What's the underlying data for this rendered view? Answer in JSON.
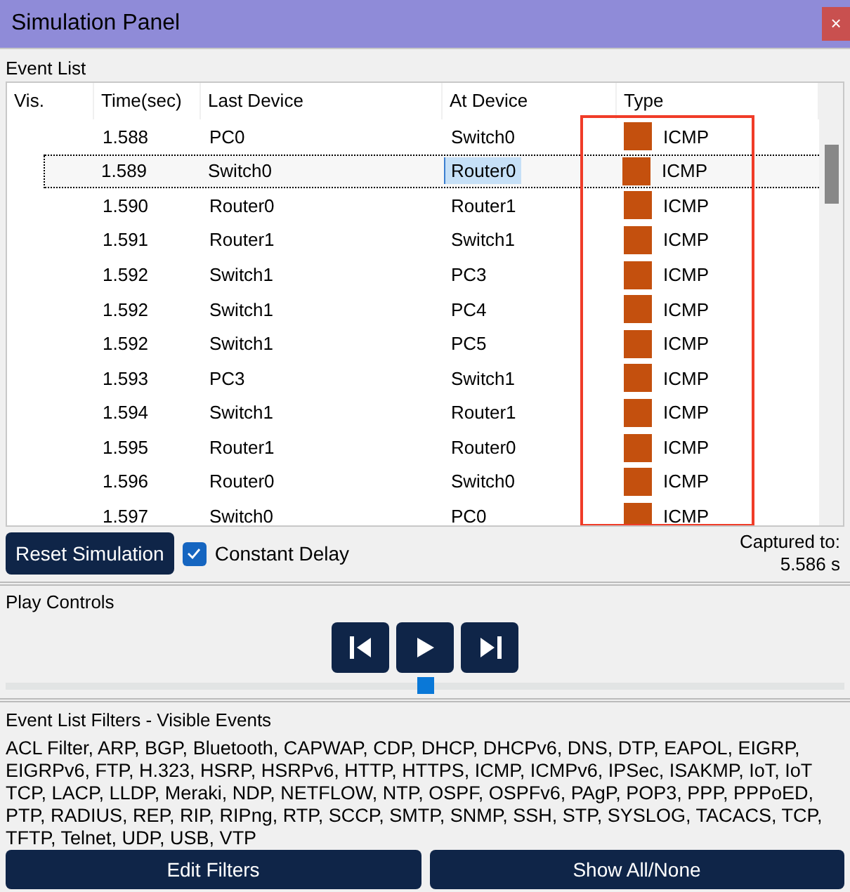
{
  "window": {
    "title": "Simulation Panel",
    "close": "×"
  },
  "event_list": {
    "label": "Event List",
    "columns": [
      "Vis.",
      "Time(sec)",
      "Last Device",
      "At Device",
      "Type"
    ],
    "rows": [
      {
        "time": "1.588",
        "last_device": "PC0",
        "at_device": "Switch0",
        "type": "ICMP",
        "color": "#c4500e",
        "selected": false
      },
      {
        "time": "1.589",
        "last_device": "Switch0",
        "at_device": "Router0",
        "type": "ICMP",
        "color": "#c4500e",
        "selected": true
      },
      {
        "time": "1.590",
        "last_device": "Router0",
        "at_device": "Router1",
        "type": "ICMP",
        "color": "#c4500e",
        "selected": false
      },
      {
        "time": "1.591",
        "last_device": "Router1",
        "at_device": "Switch1",
        "type": "ICMP",
        "color": "#c4500e",
        "selected": false
      },
      {
        "time": "1.592",
        "last_device": "Switch1",
        "at_device": "PC3",
        "type": "ICMP",
        "color": "#c4500e",
        "selected": false
      },
      {
        "time": "1.592",
        "last_device": "Switch1",
        "at_device": "PC4",
        "type": "ICMP",
        "color": "#c4500e",
        "selected": false
      },
      {
        "time": "1.592",
        "last_device": "Switch1",
        "at_device": "PC5",
        "type": "ICMP",
        "color": "#c4500e",
        "selected": false
      },
      {
        "time": "1.593",
        "last_device": "PC3",
        "at_device": "Switch1",
        "type": "ICMP",
        "color": "#c4500e",
        "selected": false
      },
      {
        "time": "1.594",
        "last_device": "Switch1",
        "at_device": "Router1",
        "type": "ICMP",
        "color": "#c4500e",
        "selected": false
      },
      {
        "time": "1.595",
        "last_device": "Router1",
        "at_device": "Router0",
        "type": "ICMP",
        "color": "#c4500e",
        "selected": false
      },
      {
        "time": "1.596",
        "last_device": "Router0",
        "at_device": "Switch0",
        "type": "ICMP",
        "color": "#c4500e",
        "selected": false
      },
      {
        "time": "1.597",
        "last_device": "Switch0",
        "at_device": "PC0",
        "type": "ICMP",
        "color": "#c4500e",
        "selected": false
      }
    ]
  },
  "reset_button": "Reset Simulation",
  "constant_delay": {
    "label": "Constant Delay",
    "checked": true
  },
  "captured": {
    "label": "Captured to:",
    "value": "5.586 s"
  },
  "play_controls": {
    "label": "Play Controls",
    "level": 0.5
  },
  "filters": {
    "label": "Event List Filters - Visible Events",
    "text": "ACL Filter, ARP, BGP, Bluetooth, CAPWAP, CDP, DHCP, DHCPv6, DNS, DTP, EAPOL, EIGRP, EIGRPv6, FTP, H.323, HSRP, HSRPv6, HTTP, HTTPS, ICMP, ICMPv6, IPSec, ISAKMP, IoT, IoT TCP, LACP, LLDP, Meraki, NDP, NETFLOW, NTP, OSPF, OSPFv6, PAgP, POP3, PPP, PPPoED, PTP, RADIUS, REP, RIP, RIPng, RTP, SCCP, SMTP, SNMP, SSH, STP, SYSLOG, TACACS, TCP, TFTP, Telnet, UDP, USB, VTP"
  },
  "buttons": [
    "Edit Filters",
    "Show All/None"
  ]
}
